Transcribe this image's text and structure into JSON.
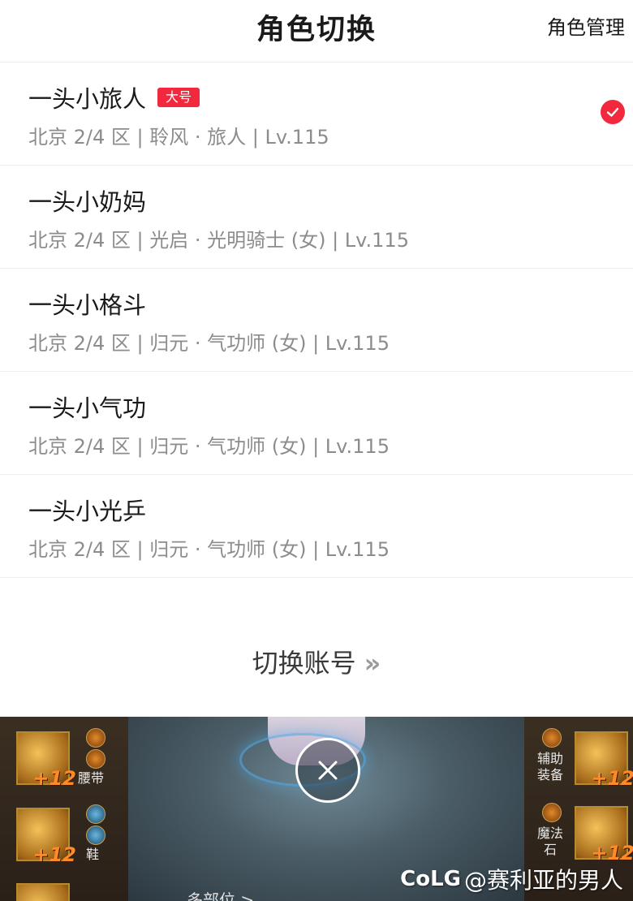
{
  "header": {
    "title": "角色切换",
    "manage_label": "角色管理"
  },
  "roles": [
    {
      "name": "一头小旅人",
      "badge": "大号",
      "info": "北京 2/4 区 | 聆风 · 旅人 | Lv.115",
      "selected": true
    },
    {
      "name": "一头小奶妈",
      "badge": "",
      "info": "北京 2/4 区 | 光启 · 光明骑士 (女) | Lv.115",
      "selected": false
    },
    {
      "name": "一头小格斗",
      "badge": "",
      "info": "北京 2/4 区 | 归元 · 气功师 (女) | Lv.115",
      "selected": false
    },
    {
      "name": "一头小气功",
      "badge": "",
      "info": "北京 2/4 区 | 归元 · 气功师 (女) | Lv.115",
      "selected": false
    },
    {
      "name": "一头小光乒",
      "badge": "",
      "info": "北京 2/4 区 | 归元 · 气功师 (女) | Lv.115",
      "selected": false
    }
  ],
  "switch_account": {
    "label": "切换账号",
    "chevron": "»"
  },
  "game": {
    "left_labels": [
      "腰带",
      "鞋"
    ],
    "right_labels": [
      "辅助\n装备",
      "魔法\n石"
    ],
    "plus_values": [
      "+12",
      "+12",
      "+12",
      "+12"
    ],
    "close_icon": "close-icon",
    "bottom_text": "多部位 >"
  },
  "watermark": {
    "logo": "CoLG",
    "text": "@赛利亚的男人"
  },
  "colors": {
    "accent": "#f2293e",
    "subtext": "#8c8c8c"
  }
}
